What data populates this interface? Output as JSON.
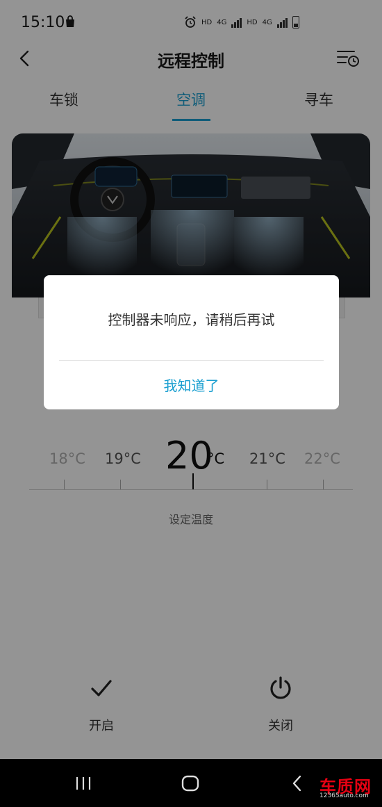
{
  "status_bar": {
    "time": "15:10",
    "hd_1": "HD",
    "net_1": "4G",
    "hd_2": "HD",
    "net_2": "4G"
  },
  "header": {
    "title": "远程控制"
  },
  "tabs": [
    {
      "label": "车锁",
      "active": false
    },
    {
      "label": "空调",
      "active": true
    },
    {
      "label": "寻车",
      "active": false
    }
  ],
  "temperature": {
    "options": [
      "18°C",
      "19°C",
      "20",
      "21°C",
      "22°C"
    ],
    "selected_value": "20",
    "selected_unit": "°C",
    "caption": "设定温度"
  },
  "actions": {
    "on_label": "开启",
    "off_label": "关闭"
  },
  "dialog": {
    "message": "控制器未响应，请稍后再试",
    "confirm_label": "我知道了"
  },
  "watermark": "www.12365auto.com",
  "brand": {
    "name": "车质网",
    "url": "12365auto.com"
  },
  "colors": {
    "accent": "#1a9fd0",
    "brand_red": "#e60012"
  }
}
